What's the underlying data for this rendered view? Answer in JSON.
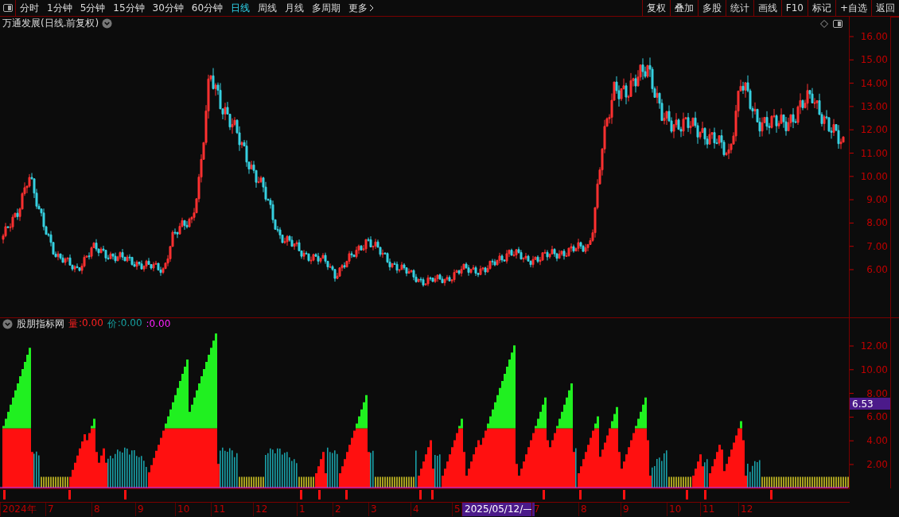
{
  "toolbar": {
    "periods": [
      {
        "label": "分时",
        "selected": false
      },
      {
        "label": "1分钟",
        "selected": false
      },
      {
        "label": "5分钟",
        "selected": false
      },
      {
        "label": "15分钟",
        "selected": false
      },
      {
        "label": "30分钟",
        "selected": false
      },
      {
        "label": "60分钟",
        "selected": false
      },
      {
        "label": "日线",
        "selected": true
      },
      {
        "label": "周线",
        "selected": false
      },
      {
        "label": "月线",
        "selected": false
      },
      {
        "label": "多周期",
        "selected": false
      },
      {
        "label": "更多",
        "selected": false
      }
    ],
    "buttons": [
      "复权",
      "叠加",
      "多股",
      "统计",
      "画线",
      "F10",
      "标记",
      "+自选",
      "返回"
    ]
  },
  "chart": {
    "title": "万通发展(日线.前复权)",
    "price_axis": [
      "16.00",
      "15.00",
      "14.00",
      "13.00",
      "12.00",
      "11.00",
      "10.00",
      "9.00",
      "8.00",
      "7.00",
      "6.00"
    ]
  },
  "indicator": {
    "name": "股朋指标网",
    "legend": [
      {
        "label": "量",
        "value": ":0.00",
        "color": "#ff2020"
      },
      {
        "label": "价",
        "value": ":0.00",
        "color": "#16a0a0"
      },
      {
        "value": ":0.00",
        "color": "#ff20ff"
      }
    ],
    "axis": [
      "12.00",
      "10.00",
      "8.00",
      "6.00",
      "4.00",
      "2.00"
    ],
    "current_value": "6.53"
  },
  "date_axis": [
    {
      "label": "2024年",
      "kind": "month"
    },
    {
      "label": "7",
      "kind": "month"
    },
    {
      "label": "8",
      "kind": "month"
    },
    {
      "label": "9",
      "kind": "month"
    },
    {
      "label": "10",
      "kind": "month"
    },
    {
      "label": "11",
      "kind": "month"
    },
    {
      "label": "12",
      "kind": "month"
    },
    {
      "label": "1",
      "kind": "month"
    },
    {
      "label": "2",
      "kind": "month"
    },
    {
      "label": "3",
      "kind": "month"
    },
    {
      "label": "4",
      "kind": "month"
    },
    {
      "label": "5",
      "kind": "month"
    },
    {
      "label": "2025/05/12/—",
      "kind": "cursor"
    },
    {
      "label": "7",
      "kind": "month"
    },
    {
      "label": "8",
      "kind": "month"
    },
    {
      "label": "9",
      "kind": "month"
    },
    {
      "label": "10",
      "kind": "month"
    },
    {
      "label": "11",
      "kind": "month"
    },
    {
      "label": "12",
      "kind": "month"
    }
  ]
}
